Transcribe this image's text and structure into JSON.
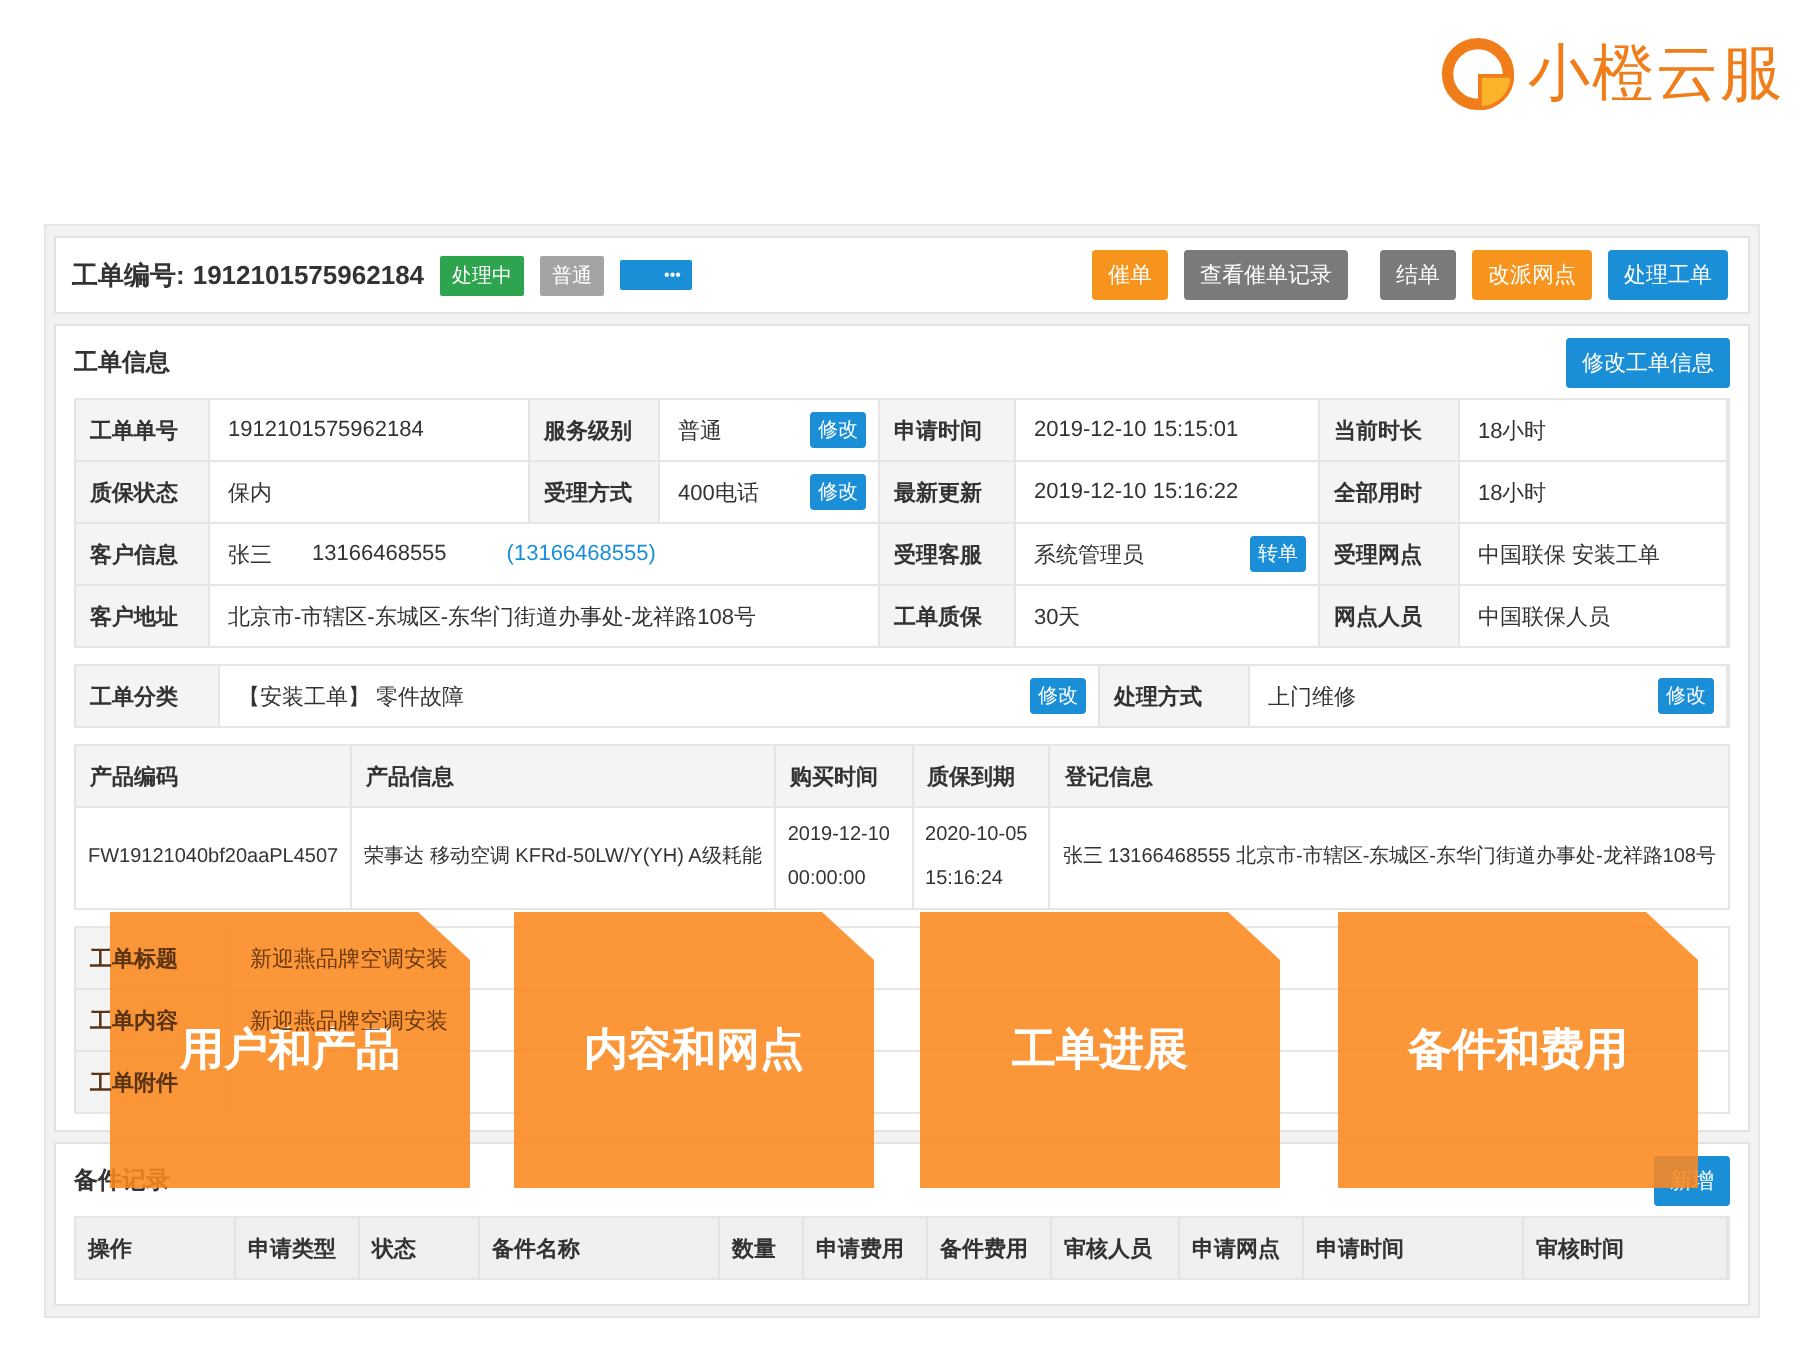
{
  "logo": {
    "text": "小橙云服"
  },
  "header": {
    "label": "工单编号:",
    "number": "1912101575962184",
    "badges": [
      {
        "text": "处理中",
        "color": "#2ea44f"
      },
      {
        "text": "普通",
        "color": "#a3a3a3"
      },
      {
        "text": "•••",
        "color": "#1a8fd8"
      }
    ],
    "buttons": [
      {
        "label": "催单",
        "color": "#f7941d"
      },
      {
        "label": "查看催单记录",
        "color": "#7a7a7a"
      },
      {
        "label": "结单",
        "color": "#7a7a7a"
      },
      {
        "label": "改派网点",
        "color": "#f7941d"
      },
      {
        "label": "处理工单",
        "color": "#1a8fd8"
      }
    ]
  },
  "info": {
    "title": "工单信息",
    "edit_button": "修改工单信息",
    "rows": [
      [
        {
          "label": "工单单号",
          "value": "1912101575962184"
        },
        {
          "label": "服务级别",
          "value": "普通",
          "action": "修改"
        },
        {
          "label": "申请时间",
          "value": "2019-12-10 15:15:01"
        },
        {
          "label": "当前时长",
          "value": "18小时"
        }
      ],
      [
        {
          "label": "质保状态",
          "value": "保内"
        },
        {
          "label": "受理方式",
          "value": "400电话",
          "action": "修改"
        },
        {
          "label": "最新更新",
          "value": "2019-12-10 15:16:22"
        },
        {
          "label": "全部用时",
          "value": "18小时"
        }
      ],
      [
        {
          "label": "客户信息",
          "kind": "wide",
          "parts": [
            "张三",
            "13166468555"
          ],
          "link": "(13166468555)"
        },
        {
          "label": "受理客服",
          "value": "系统管理员",
          "action": "转单"
        },
        {
          "label": "受理网点",
          "value": "中国联保 安装工单"
        }
      ],
      [
        {
          "label": "客户地址",
          "kind": "wide",
          "value": "北京市-市辖区-东城区-东华门街道办事处-龙祥路108号"
        },
        {
          "label": "工单质保",
          "value": "30天"
        },
        {
          "label": "网点人员",
          "value": "中国联保人员"
        }
      ]
    ],
    "category": [
      {
        "label": "工单分类",
        "value": "【安装工单】 零件故障",
        "action": "修改"
      },
      {
        "label": "处理方式",
        "value": "上门维修",
        "action": "修改"
      }
    ],
    "products": {
      "columns": [
        "产品编码",
        "产品信息",
        "购买时间",
        "质保到期",
        "登记信息"
      ],
      "rows": [
        [
          "FW19121040bf20aaPL4507",
          "荣事达 移动空调 KFRd-50LW/Y(YH) A级耗能",
          "2019-12-10 00:00:00",
          "2020-10-05 15:16:24",
          "张三 13166468555 北京市-市辖区-东城区-东华门街道办事处-龙祥路108号"
        ]
      ]
    },
    "details": [
      {
        "label": "工单标题",
        "value": "新迎燕品牌空调安装"
      },
      {
        "label": "工单内容",
        "value": "新迎燕品牌空调安装"
      },
      {
        "label": "工单附件"
      }
    ]
  },
  "parts": {
    "title": "备件记录",
    "add_button": "新增",
    "columns": [
      "操作",
      "申请类型",
      "状态",
      "备件名称",
      "数量",
      "申请费用",
      "备件费用",
      "审核人员",
      "申请网点",
      "申请时间",
      "审核时间"
    ]
  },
  "overlay": [
    "用户和产品",
    "内容和网点",
    "工单进展",
    "备件和费用"
  ]
}
